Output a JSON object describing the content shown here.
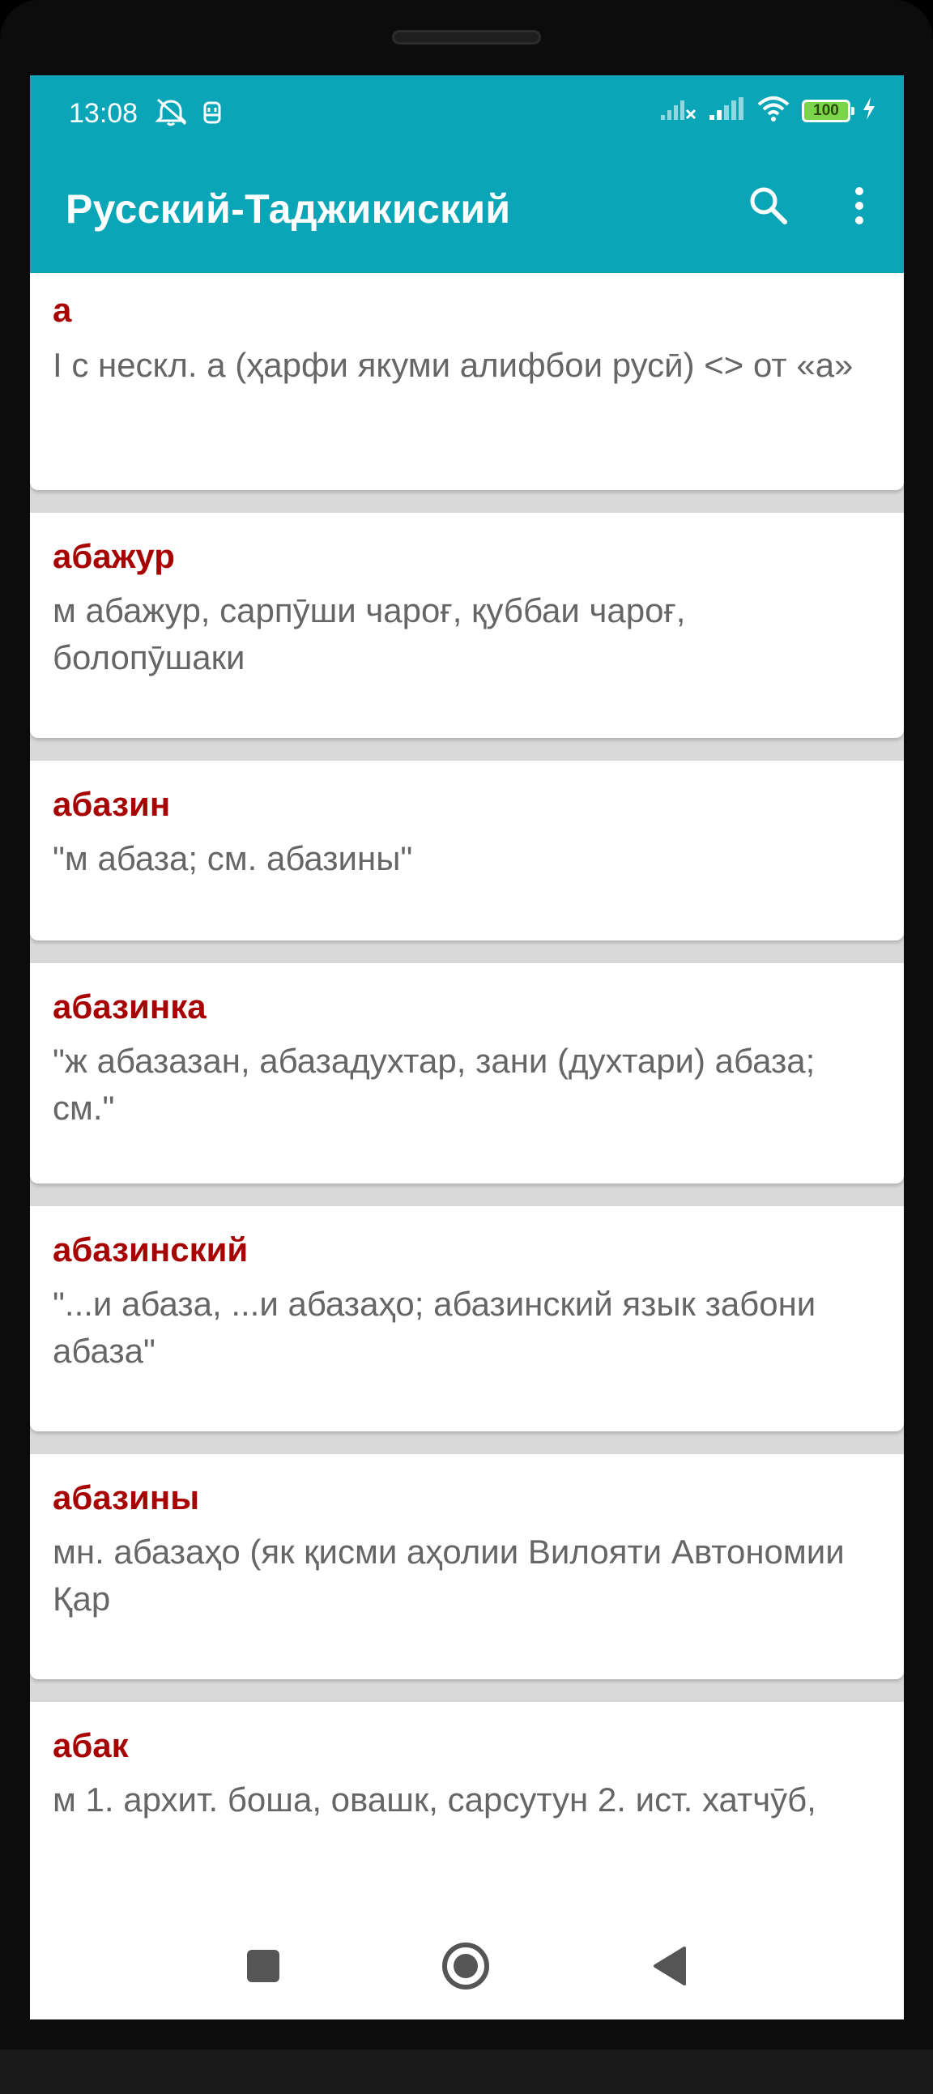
{
  "status_bar": {
    "time": "13:08",
    "battery_level": "100",
    "icons": [
      "alarm-off-icon",
      "usb-icon",
      "signal-weak-icon",
      "signal-icon",
      "wifi-icon",
      "battery-icon",
      "charging-bolt-icon"
    ]
  },
  "app_bar": {
    "title": "Русский-Таджикиский",
    "actions": [
      "search-icon",
      "more-vert-icon"
    ]
  },
  "entries": [
    {
      "word": "а",
      "definition": "I с нескл. а (ҳарфи якуми алифбои русӣ) <> от «а»"
    },
    {
      "word": "абажур",
      "definition": "м абажур, сарпӯши чароғ, қуббаи чароғ, болопӯшаки"
    },
    {
      "word": "абазин",
      "definition": "\"м абаза; см. абазины\""
    },
    {
      "word": "абазинка",
      "definition": "\"ж абазазан, абазадухтар, зани (духтари) абаза; см.\""
    },
    {
      "word": "абазинский",
      "definition": "\"...и абаза, ...и абазаҳо; абазинский язык забони абаза\""
    },
    {
      "word": "абазины",
      "definition": "мн. абазаҳо (як қисми аҳолии Вилояти Автономии Қар"
    },
    {
      "word": "абак",
      "definition": "м 1. архит. боша, овашк, сарсутун 2. ист. хатчӯб,"
    }
  ],
  "nav_bar": {
    "buttons": [
      "recents-square-icon",
      "home-circle-icon",
      "back-triangle-icon"
    ]
  },
  "colors": {
    "accent": "#0aa5b6",
    "headword": "#a80303",
    "definition": "#666666",
    "separator": "#d9d9d9"
  }
}
